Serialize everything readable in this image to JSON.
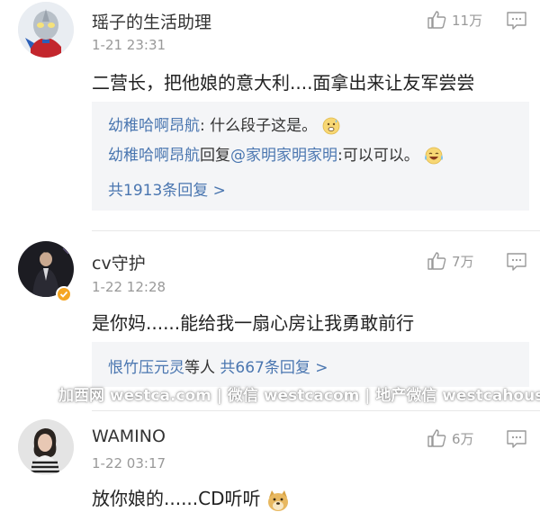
{
  "comments": [
    {
      "username": "瑶子的生活助理",
      "time": "1-21 23:31",
      "likes": "11万",
      "avatar_icon": "ultraman-avatar-icon",
      "text": "二营长，把他娘的意大利....面拿出来让友军尝尝",
      "sub_replies": [
        {
          "user": "幼稚哈啊昂航",
          "content": ": 什么段子这是。",
          "emoji": "sweat-smile-emoji"
        },
        {
          "user": "幼稚哈啊昂航",
          "reply_word": "回复",
          "mention": "@家明家明家明",
          "content": ":可以可以。",
          "emoji": "laugh-cry-emoji"
        }
      ],
      "more_replies": "共1913条回复 >"
    },
    {
      "username": "cv守护",
      "time": "1-22 12:28",
      "likes": "7万",
      "avatar_icon": "dark-portrait-avatar-icon",
      "verified": true,
      "text": "是你妈......能给我一扇心房让我勇敢前行",
      "reply_summary": {
        "user": "恨竹压元灵",
        "suffix": "等人",
        "count": "共667条回复 >"
      }
    },
    {
      "username": "WAMINO",
      "time": "1-22 03:17",
      "likes": "6万",
      "avatar_icon": "girl-portrait-avatar-icon",
      "text": "放你娘的......CD听听",
      "emoji": "doge-emoji"
    }
  ],
  "watermark": "加西网 westca.com | 微信 westcacom | 地产微信 westcahouse",
  "colors": {
    "link": "#4a76b0",
    "meta": "#999999",
    "subbox_bg": "#f4f5f7",
    "verified": "#f5a623"
  }
}
